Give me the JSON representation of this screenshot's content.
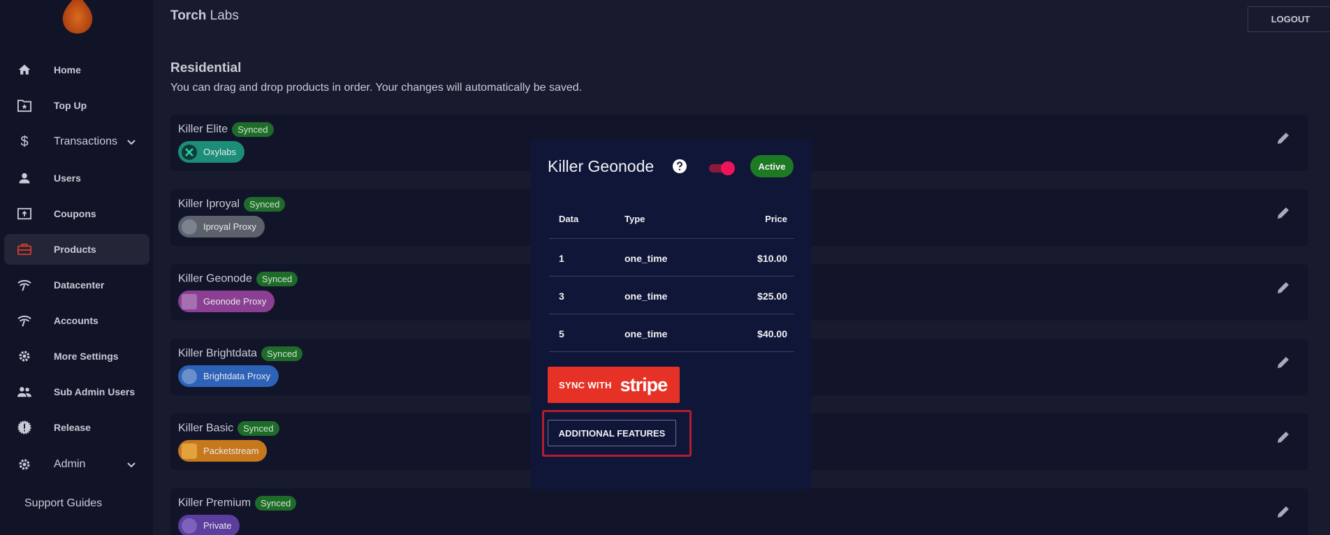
{
  "sidebar": {
    "items": [
      {
        "label": "Home",
        "icon": "home-icon"
      },
      {
        "label": "Top Up",
        "icon": "folder-star-icon"
      },
      {
        "label": "Transactions",
        "icon": "dollar-icon"
      },
      {
        "label": "Users",
        "icon": "user-icon"
      },
      {
        "label": "Coupons",
        "icon": "coupon-icon"
      },
      {
        "label": "Products",
        "icon": "briefcase-icon"
      },
      {
        "label": "Datacenter",
        "icon": "wifi-icon"
      },
      {
        "label": "Accounts",
        "icon": "wifi-icon"
      },
      {
        "label": "More Settings",
        "icon": "gear-icon"
      },
      {
        "label": "Sub Admin Users",
        "icon": "users-icon"
      },
      {
        "label": "Release",
        "icon": "badge-alert-icon"
      },
      {
        "label": "Admin",
        "icon": "gear-icon"
      }
    ],
    "support": "Support Guides"
  },
  "header": {
    "brand_bold": "Torch",
    "brand_rest": " Labs",
    "logout": "LOGOUT"
  },
  "section": {
    "title": "Residential",
    "subtitle": "You can drag and drop products in order. Your changes will automatically be saved."
  },
  "products": [
    {
      "name": "Killer Elite",
      "status": "Synced",
      "provider": "Oxylabs"
    },
    {
      "name": "Killer Iproyal",
      "status": "Synced",
      "provider": "Iproyal Proxy"
    },
    {
      "name": "Killer Geonode",
      "status": "Synced",
      "provider": "Geonode Proxy"
    },
    {
      "name": "Killer Brightdata",
      "status": "Synced",
      "provider": "Brightdata Proxy"
    },
    {
      "name": "Killer Basic",
      "status": "Synced",
      "provider": "Packetstream"
    },
    {
      "name": "Killer Premium",
      "status": "Synced",
      "provider": "Private"
    }
  ],
  "modal": {
    "title": "Killer Geonode",
    "status": "Active",
    "toggle_on": true,
    "columns": [
      "Data",
      "Type",
      "Price"
    ],
    "rows": [
      {
        "data": "1",
        "type": "one_time",
        "price": "$10.00"
      },
      {
        "data": "3",
        "type": "one_time",
        "price": "$25.00"
      },
      {
        "data": "5",
        "type": "one_time",
        "price": "$40.00"
      }
    ],
    "sync_prefix": "SYNC WITH",
    "sync_brand": "stripe",
    "features_button": "ADDITIONAL FEATURES"
  },
  "colors": {
    "accent_red": "#e63226",
    "synced_green": "#1f6b2a",
    "toggle_pink": "#f0135a",
    "highlight_outline": "#b21e2e"
  }
}
